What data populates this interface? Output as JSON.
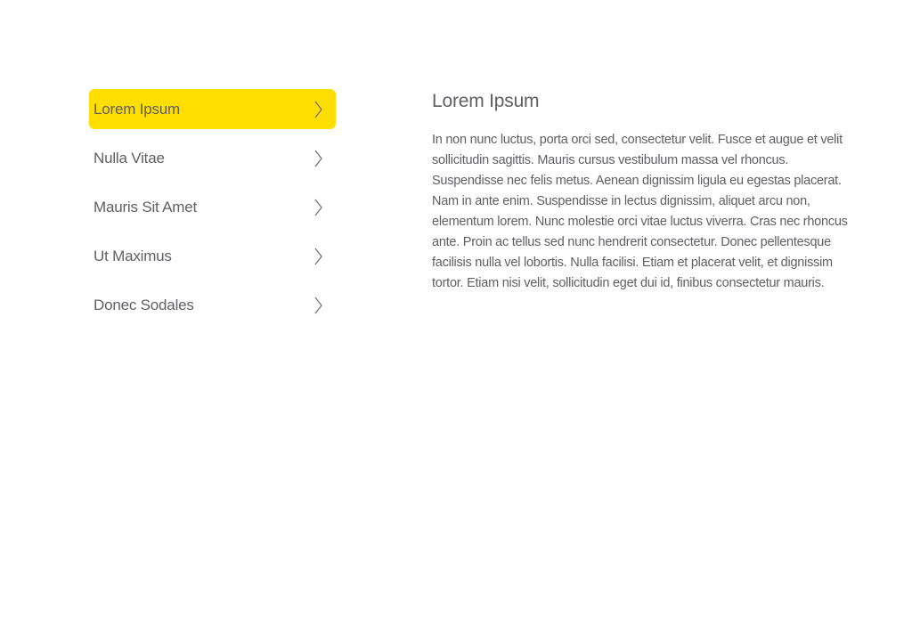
{
  "menu": {
    "items": [
      {
        "label": "Lorem Ipsum",
        "active": true,
        "icon": "chevron-right-icon"
      },
      {
        "label": "Nulla Vitae",
        "active": false,
        "icon": "chevron-right-icon"
      },
      {
        "label": "Mauris Sit Amet",
        "active": false,
        "icon": "chevron-right-icon"
      },
      {
        "label": "Ut Maximus",
        "active": false,
        "icon": "chevron-right-icon"
      },
      {
        "label": "Donec Sodales",
        "active": false,
        "icon": "chevron-right-icon"
      }
    ],
    "active_color": "#ffde00"
  },
  "content": {
    "title": "Lorem Ipsum",
    "body": "In non nunc luctus, porta orci sed, consectetur velit. Fusce et augue et velit sollicitudin sagittis. Mauris cursus vestibulum massa vel rhoncus. Suspendisse nec felis metus. Aenean dignissim ligula eu egestas placerat. Nam in ante enim. Suspendisse in lectus dignissim, aliquet arcu non, elementum lorem. Nunc molestie orci vitae luctus viverra. Cras nec rhoncus ante. Proin ac tellus sed nunc hendrerit consectetur. Donec pellentesque facilisis nulla vel lobortis. Nulla facilisi. Etiam et placerat velit, et dignissim tortor. Etiam nisi velit, sollicitudin eget dui id, finibus consectetur mauris."
  },
  "colors": {
    "text": "#5f5f66",
    "background": "#ffffff"
  }
}
